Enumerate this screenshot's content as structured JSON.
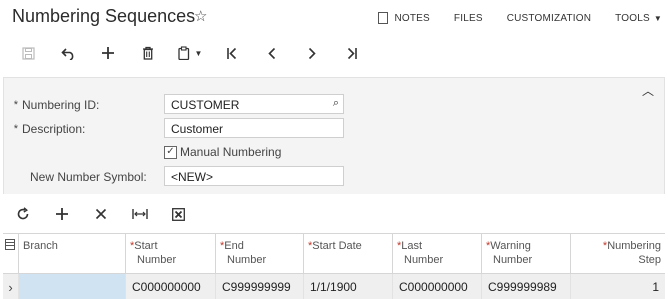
{
  "header": {
    "title": "Numbering Sequences",
    "favorite_icon": "star-outline-icon",
    "links": [
      {
        "id": "notes",
        "label": "NOTES",
        "icon": "notes-icon"
      },
      {
        "id": "files",
        "label": "FILES"
      },
      {
        "id": "customization",
        "label": "CUSTOMIZATION"
      },
      {
        "id": "tools",
        "label": "TOOLS",
        "icon": "chevron-down-icon"
      }
    ]
  },
  "toolbar": {
    "buttons": [
      {
        "id": "save",
        "icon": "save-icon",
        "enabled": false
      },
      {
        "id": "undo",
        "icon": "undo-icon",
        "enabled": true
      },
      {
        "id": "add",
        "icon": "plus-icon",
        "enabled": true
      },
      {
        "id": "delete",
        "icon": "trash-icon",
        "enabled": true
      },
      {
        "id": "copy-paste",
        "icon": "clipboard-icon",
        "enabled": true
      },
      {
        "id": "first",
        "icon": "first-record-icon",
        "enabled": true
      },
      {
        "id": "prev",
        "icon": "previous-record-icon",
        "enabled": true
      },
      {
        "id": "next",
        "icon": "next-record-icon",
        "enabled": true
      },
      {
        "id": "last",
        "icon": "last-record-icon",
        "enabled": true
      }
    ]
  },
  "form": {
    "numbering_id": {
      "label": "Numbering ID:",
      "required": true,
      "value": "CUSTOMER"
    },
    "description": {
      "label": "Description:",
      "required": true,
      "value": "Customer"
    },
    "manual_numbering": {
      "label": "Manual Numbering",
      "checked": true
    },
    "new_number_symbol": {
      "label": "New Number Symbol:",
      "value": "<NEW>"
    },
    "required_marker": "*"
  },
  "grid_toolbar": {
    "buttons": [
      {
        "id": "refresh",
        "icon": "refresh-icon"
      },
      {
        "id": "add-row",
        "icon": "plus-icon"
      },
      {
        "id": "delete-row",
        "icon": "close-icon"
      },
      {
        "id": "fit-columns",
        "icon": "fit-to-width-icon"
      },
      {
        "id": "export-excel",
        "icon": "excel-icon"
      }
    ]
  },
  "grid": {
    "columns": [
      {
        "id": "branch",
        "line1": "Branch",
        "line2": "",
        "required": false
      },
      {
        "id": "start_number",
        "line1": "Start",
        "line2": "Number",
        "required": true
      },
      {
        "id": "end_number",
        "line1": "End",
        "line2": "Number",
        "required": true
      },
      {
        "id": "start_date",
        "line1": "Start Date",
        "line2": "",
        "required": true
      },
      {
        "id": "last_number",
        "line1": "Last",
        "line2": "Number",
        "required": true
      },
      {
        "id": "warning_number",
        "line1": "Warning",
        "line2": "Number",
        "required": true
      },
      {
        "id": "numbering_step",
        "line1": "Numbering",
        "line2": "Step",
        "required": true
      }
    ],
    "rows": [
      {
        "branch": "",
        "start_number": "C000000000",
        "end_number": "C999999999",
        "start_date": "1/1/1900",
        "last_number": "C000000000",
        "warning_number": "C999999989",
        "numbering_step": "1"
      }
    ]
  }
}
